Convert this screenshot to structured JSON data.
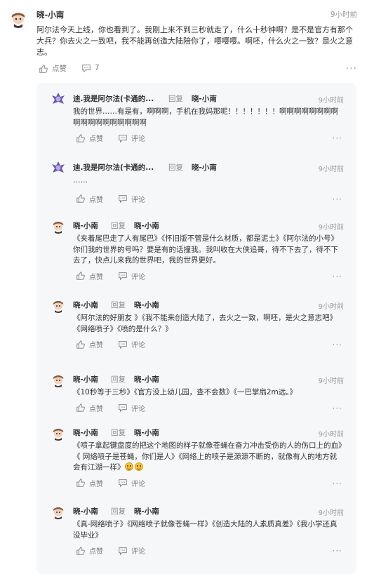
{
  "main": {
    "author": "晓-小南",
    "time": "9小时前",
    "text": "阿尔法今天上线，你也看到了。我刚上来不到三秒就走了，什么十秒钟啊？是不是官方有那个大兵？你去火之一致吧，我不能再创造大陆陪你了，嘤嘤嘤。啊呸，什么火之一致？是火之意志。",
    "like_label": "点赞",
    "comment_count": "7"
  },
  "reply_word": "回复",
  "like_label": "点赞",
  "comment_label": "评论",
  "replies": [
    {
      "author": "迪.我是阿尔法(卡通的...",
      "target": "晓-小南",
      "time": "9小时前",
      "text": "我的世界……有是有，啊啊啊，手机在我妈那呢！！！！！！！啊啊啊啊啊啊啊啊啊啊啊啊啊啊啊啊啊啊"
    },
    {
      "author": "迪.我是阿尔法(卡通的...",
      "target": "晓-小南",
      "time": "9小时前",
      "text": "……"
    },
    {
      "author": "晓-小南",
      "target": "晓-小南",
      "time": "9小时前",
      "text": "《夹着尾巴走了人有尾巴》《怀旧版不管是什么材质，都是泥土》《阿尔法的小号》你们我的世界的号吗？要是有的话撞我。我叫收在大侠追哥，待不下去了，待不下去了，快点儿来我的世界吧，我的世界更好。"
    },
    {
      "author": "晓-小南",
      "target": "晓-小南",
      "time": "9小时前",
      "text": "《阿尔法的好朋友 》《我不能来创造大陆了，去火之一致，啊呸，是火之意志吧》《网络喷子》《喷的是什么？》"
    },
    {
      "author": "晓-小南",
      "target": "晓-小南",
      "time": "9小时前",
      "text": "《10秒等于三秒》《官方没上幼儿园，查不会数》《一巴掌扇2m远。》"
    },
    {
      "author": "晓-小南",
      "target": "晓-小南",
      "time": "9小时前",
      "text": "《喷子拿起键盘度的把这个地图的样子就像苍蝇在奋力冲击受伤的人的伤口上的血》《 网络喷子是苍蝇，你们是人》《网络上的喷子是源源不断的，就像有人的地方就会有江湖一样》"
    },
    {
      "author": "晓-小南",
      "target": "晓-小南",
      "time": "9小时前",
      "text": "《真-网络喷子》《网络喷子就像苍蝇一样》《创造大陆的人素质真差》《我小学还真没毕业》"
    }
  ]
}
